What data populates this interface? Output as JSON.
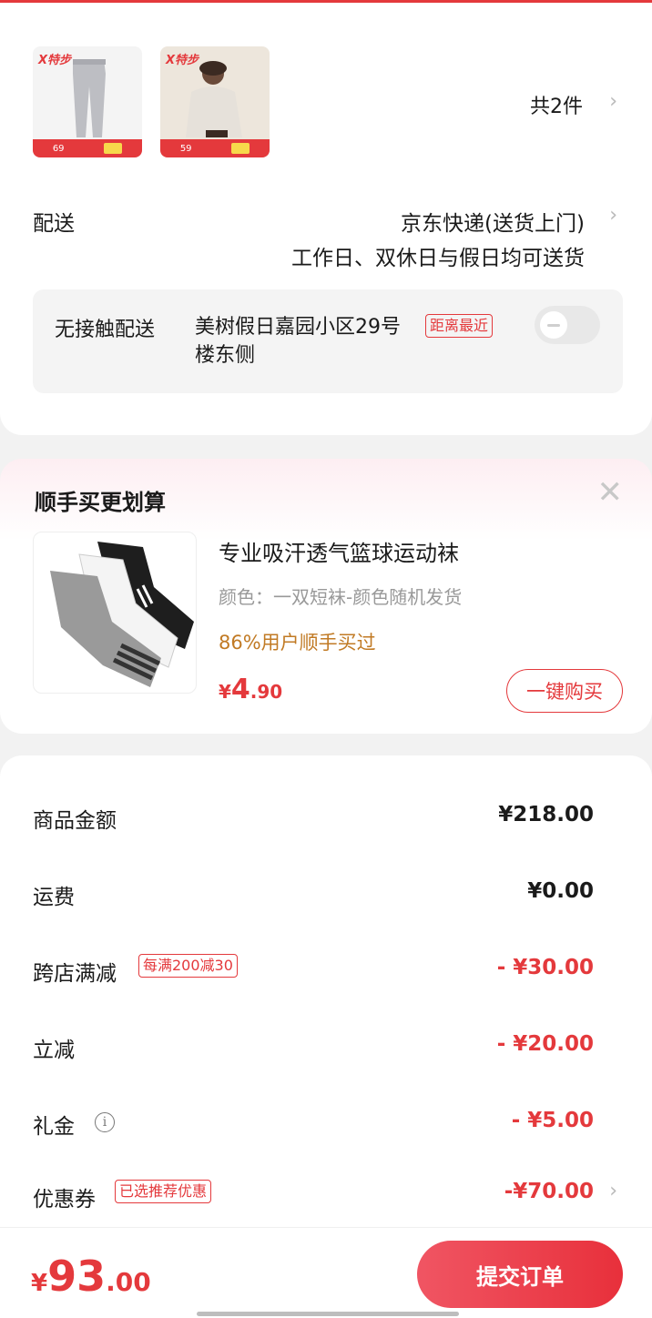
{
  "cart": {
    "count_label": "共2件",
    "thumbs": [
      {
        "brand": "X特步",
        "price": "69"
      },
      {
        "brand": "X特步",
        "price": "59"
      }
    ]
  },
  "delivery": {
    "label": "配送",
    "method": "京东快递(送货上门)",
    "schedule": "工作日、双休日与假日均可送货",
    "contactless_label": "无接触配送",
    "contactless_addr": "美树假日嘉园小区29号楼东侧",
    "nearest_badge": "距离最近",
    "contactless_on": false
  },
  "upsell": {
    "title": "顺手买更划算",
    "product_name": "专业吸汗透气篮球运动袜",
    "spec": "颜色：一双短袜-颜色随机发货",
    "hint": "86%用户顺手买过",
    "price_symbol": "¥",
    "price_int": "4",
    "price_dec": ".90",
    "buy_label": "一键购买"
  },
  "summary": {
    "goods_label": "商品金额",
    "goods_value": "¥218.00",
    "shipping_label": "运费",
    "shipping_value": "¥0.00",
    "cross_store_label": "跨店满减",
    "cross_store_badge": "每满200减30",
    "cross_store_value": "- ¥30.00",
    "instant_label": "立减",
    "instant_value": "- ¥20.00",
    "gift_label": "礼金",
    "gift_value": "- ¥5.00",
    "coupon_label": "优惠券",
    "coupon_badge": "已选推荐优惠",
    "coupon_value": "-¥70.00"
  },
  "footer": {
    "total_symbol": "¥",
    "total_int": "93",
    "total_dec": ".00",
    "submit_label": "提交订单"
  },
  "colors": {
    "accent": "#e4393c",
    "hint": "#c17a24"
  }
}
